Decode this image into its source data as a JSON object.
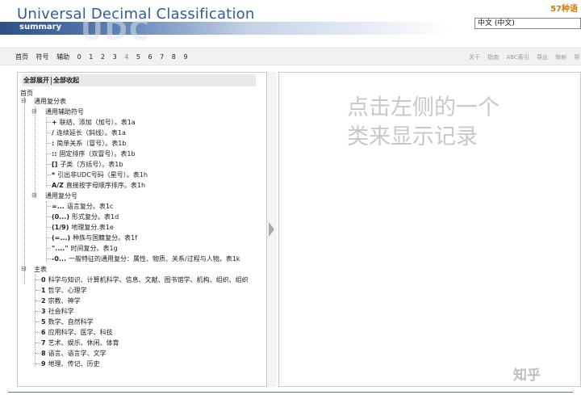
{
  "header": {
    "title": "Universal Decimal Classification",
    "subtitle": "summary",
    "watermark": "UDC",
    "brand": "57种语",
    "language_select": "中文 (中文)"
  },
  "nav": {
    "left": [
      "首页",
      "符号",
      "辅助",
      "0",
      "1",
      "2",
      "3",
      "4",
      "5",
      "6",
      "7",
      "8",
      "9"
    ],
    "right": [
      "关于",
      "指南",
      "ABC索引",
      "导出",
      "映射",
      "帮"
    ]
  },
  "toolbar": {
    "expand_all": "全部展开",
    "collapse_all": "全部收起"
  },
  "tree": {
    "root": "首页",
    "common": "通用复分表",
    "aux_signs": "通用辅助符号",
    "signs": [
      {
        "code": "+",
        "label": "联结、添加（加号）。表1a"
      },
      {
        "code": "/",
        "label": "连续延长（斜线）。表1a"
      },
      {
        "code": ":",
        "label": "简单关系（冒号）。表1b"
      },
      {
        "code": "::",
        "label": "固定排序（双冒号）。表1b"
      },
      {
        "code": "[]",
        "label": "子类（方括号）。表1b"
      },
      {
        "code": "*",
        "label": "引出非UDC号码（星号）。表1h"
      },
      {
        "code": "A/Z",
        "label": "直接按字母顺序排序。表1h"
      }
    ],
    "aux_numbers": "通用复分号",
    "numbers": [
      {
        "code": "=...",
        "label": "语言复分。表1c"
      },
      {
        "code": "(0...)",
        "label": "形式复分。表1d"
      },
      {
        "code": "(1/9)",
        "label": "地理复分.表1e"
      },
      {
        "code": "(=...)",
        "label": "种族与国籍复分。表1f"
      },
      {
        "code": "\"....\"",
        "label": "时间复分。表1g"
      },
      {
        "code": "-0...",
        "label": "一般特征的通用复分：属性、物质、关系/过程与人物。表1k"
      }
    ],
    "main": "主表",
    "classes": [
      {
        "code": "0",
        "label": "科学与知识、计算机科学、信息、文献、图书馆学、机构、组织、组织"
      },
      {
        "code": "1",
        "label": "哲学、心理学"
      },
      {
        "code": "2",
        "label": "宗教、神学"
      },
      {
        "code": "3",
        "label": "社会科学"
      },
      {
        "code": "5",
        "label": "数学、自然科学"
      },
      {
        "code": "6",
        "label": "应用科学、医学、科技"
      },
      {
        "code": "7",
        "label": "艺术、娱乐、休闲、体育"
      },
      {
        "code": "8",
        "label": "语言、语言学、文学"
      },
      {
        "code": "9",
        "label": "地理、传记、历史"
      }
    ]
  },
  "placeholder": "点击左侧的一个类来显示记录",
  "overlay_watermark": "知乎",
  "colors": {
    "title": "#2f5d9c",
    "banner": "#2c4f86",
    "brand": "#d07c00"
  }
}
